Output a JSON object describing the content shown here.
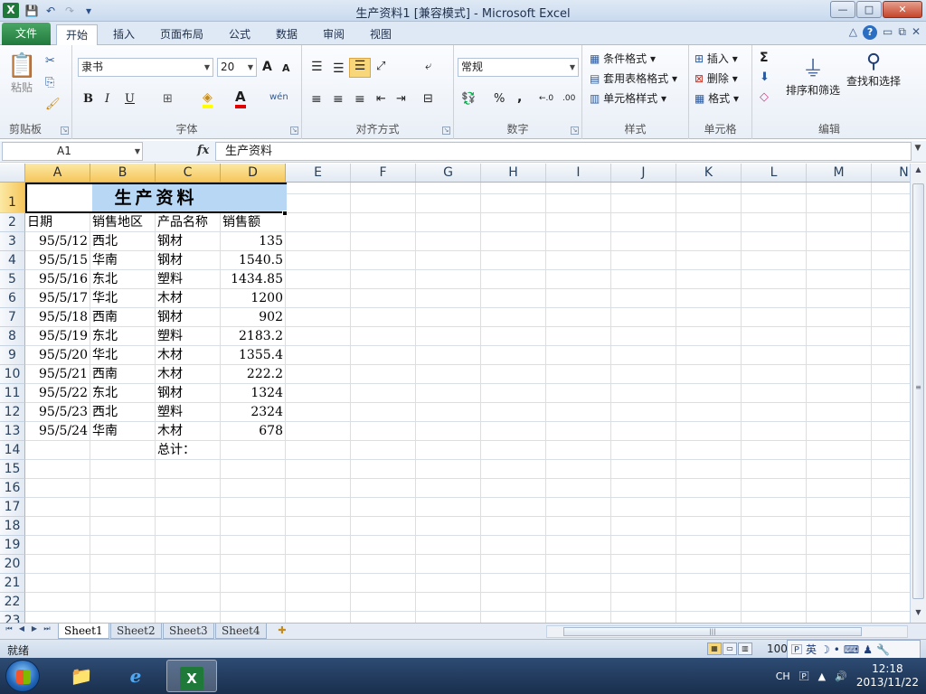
{
  "window": {
    "app_icon": "X",
    "title": "生产资料1  [兼容模式] - Microsoft Excel",
    "minimize": "—",
    "maximize": "□",
    "close": "✕"
  },
  "qat": {
    "save_icon": "💾",
    "undo_icon": "↶",
    "redo_icon": "↷",
    "customize_icon": "▾"
  },
  "tabs": {
    "file": "文件",
    "items": [
      "开始",
      "插入",
      "页面布局",
      "公式",
      "数据",
      "审阅",
      "视图"
    ],
    "active": "开始",
    "help": "?"
  },
  "ribbon": {
    "clipboard": {
      "label": "剪贴板",
      "paste": "粘贴"
    },
    "font": {
      "label": "字体",
      "font_name": "隶书",
      "font_size": "20",
      "bold": "B",
      "italic": "I",
      "underline": "U",
      "grow": "A",
      "shrink": "A",
      "font_color": "A",
      "phonetic": "wén"
    },
    "alignment": {
      "label": "对齐方式"
    },
    "number": {
      "label": "数字",
      "format": "常规",
      "percent": "%",
      "comma": ",",
      "inc_decimal": "←.0",
      "dec_decimal": ".00"
    },
    "styles": {
      "label": "样式",
      "conditional": "条件格式",
      "table": "套用表格格式",
      "cell_styles": "单元格样式"
    },
    "cells": {
      "label": "单元格",
      "insert": "插入",
      "delete": "删除",
      "format": "格式"
    },
    "editing": {
      "label": "编辑",
      "sum": "Σ",
      "sort_filter": "排序和筛选",
      "find_select": "查找和选择"
    }
  },
  "formula_bar": {
    "name_box": "A1",
    "fx": "fx",
    "value": "生产资料"
  },
  "grid": {
    "columns": [
      "A",
      "B",
      "C",
      "D",
      "E",
      "F",
      "G",
      "H",
      "I",
      "J",
      "K",
      "L",
      "M",
      "N"
    ],
    "selected_columns": [
      "A",
      "B",
      "C",
      "D"
    ],
    "rows": [
      "1",
      "2",
      "3",
      "4",
      "5",
      "6",
      "7",
      "8",
      "9",
      "10",
      "11",
      "12",
      "13",
      "14",
      "15",
      "16",
      "17",
      "18",
      "19",
      "20",
      "21",
      "22",
      "23"
    ],
    "selected_rows": [
      "1"
    ],
    "title": "生产资料",
    "headers": [
      "日期",
      "销售地区",
      "产品名称",
      "销售额"
    ],
    "data": [
      [
        "95/5/12",
        "西北",
        "钢材",
        "135"
      ],
      [
        "95/5/15",
        "华南",
        "钢材",
        "1540.5"
      ],
      [
        "95/5/16",
        "东北",
        "塑料",
        "1434.85"
      ],
      [
        "95/5/17",
        "华北",
        "木材",
        "1200"
      ],
      [
        "95/5/18",
        "西南",
        "钢材",
        "902"
      ],
      [
        "95/5/19",
        "东北",
        "塑料",
        "2183.2"
      ],
      [
        "95/5/20",
        "华北",
        "木材",
        "1355.4"
      ],
      [
        "95/5/21",
        "西南",
        "木材",
        "222.2"
      ],
      [
        "95/5/22",
        "东北",
        "钢材",
        "1324"
      ],
      [
        "95/5/23",
        "西北",
        "塑料",
        "2324"
      ],
      [
        "95/5/24",
        "华南",
        "木材",
        "678"
      ]
    ],
    "total_label": "总计："
  },
  "sheets": {
    "tabs": [
      "Sheet1",
      "Sheet2",
      "Sheet3",
      "Sheet4"
    ],
    "active": "Sheet1"
  },
  "status": {
    "text": "就绪",
    "zoom": "100"
  },
  "ime": {
    "mode": "英",
    "icon1": "🄿",
    "icon2": "☽"
  },
  "taskbar": {
    "ie": "e",
    "excel": "X",
    "lang": "CH",
    "time": "12:18",
    "date": "2013/11/22"
  }
}
